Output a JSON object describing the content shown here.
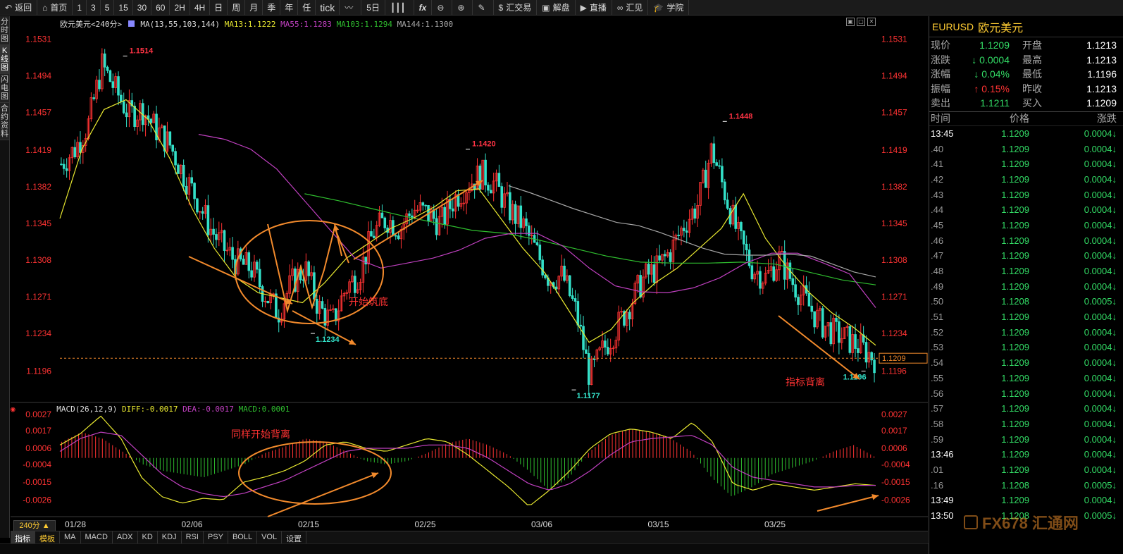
{
  "toolbar": {
    "back": "返回",
    "home": "首页",
    "periods": [
      "1",
      "3",
      "5",
      "15",
      "30",
      "60",
      "2H",
      "4H",
      "日",
      "周",
      "月",
      "季",
      "年",
      "任",
      "tick"
    ],
    "five_day": "5日",
    "fx": "fx",
    "fx_trade": "汇交易",
    "jiepan": "解盘",
    "live": "直播",
    "huijian": "汇见",
    "academy": "学院"
  },
  "left_tabs": [
    "分时图",
    "K线图",
    "闪电图",
    "合约资料"
  ],
  "chart": {
    "title": "欧元美元<240分>",
    "ma_legend": {
      "label": "MA(13,55,103,144)",
      "ma13": "MA13:1.1222",
      "ma55": "MA55:1.1283",
      "ma103": "MA103:1.1294",
      "ma144": "MA144:1.1300"
    },
    "macd_legend": {
      "label": "MACD(26,12,9)",
      "diff": "DIFF:-0.0017",
      "dea": "DEA:-0.0017",
      "macd": "MACD:0.0001"
    },
    "period_button": "240分 ▲",
    "current_price_tag": "1.1209",
    "colors": {
      "up": "#ff3333",
      "down": "#33e0c8",
      "ma13": "#e8e830",
      "ma55": "#2fbf2f",
      "ma103": "#c040c0",
      "ma144": "#a8a8a8",
      "annotation": "#f28a2c"
    },
    "annotations": {
      "start_bottom": "开始筑底",
      "same_divergence": "同样开始背离",
      "indicator_divergence": "指标背离"
    }
  },
  "chart_data": [
    {
      "type": "candlestick",
      "title": "欧元美元<240分>",
      "y_ticks": [
        "1.1531",
        "1.1494",
        "1.1457",
        "1.1419",
        "1.1382",
        "1.1345",
        "1.1308",
        "1.1271",
        "1.1234",
        "1.1196"
      ],
      "x_ticks": [
        "01/28",
        "02/06",
        "02/15",
        "02/25",
        "03/06",
        "03/15",
        "03/25"
      ],
      "ylim": [
        1.117,
        1.154
      ],
      "price_labels": [
        {
          "text": "1.1514",
          "value": 1.1514,
          "x_date": "01/31"
        },
        {
          "text": "1.1420",
          "value": 1.142,
          "x_date": "02/22"
        },
        {
          "text": "1.1448",
          "value": 1.1448,
          "x_date": "03/18"
        },
        {
          "text": "1.1234",
          "value": 1.1234,
          "x_date": "02/15"
        },
        {
          "text": "1.1177",
          "value": 1.1177,
          "x_date": "03/07"
        },
        {
          "text": "1.1196",
          "value": 1.1196,
          "x_date": "03/30"
        }
      ],
      "current_price": 1.1209,
      "close_path": [
        1.1405,
        1.142,
        1.1445,
        1.1505,
        1.148,
        1.1455,
        1.146,
        1.144,
        1.1425,
        1.1395,
        1.137,
        1.134,
        1.132,
        1.1305,
        1.13,
        1.1275,
        1.1255,
        1.1285,
        1.13,
        1.126,
        1.1245,
        1.128,
        1.1295,
        1.1335,
        1.135,
        1.134,
        1.136,
        1.1355,
        1.1345,
        1.137,
        1.1385,
        1.1395,
        1.1385,
        1.136,
        1.1345,
        1.1318,
        1.129,
        1.1292,
        1.1255,
        1.119,
        1.1218,
        1.124,
        1.1265,
        1.129,
        1.13,
        1.1318,
        1.1345,
        1.1365,
        1.142,
        1.1375,
        1.133,
        1.13,
        1.129,
        1.131,
        1.1285,
        1.1265,
        1.1245,
        1.1235,
        1.1228,
        1.122,
        1.1209
      ],
      "ma13": [
        1.135,
        1.142,
        1.146,
        1.147,
        1.145,
        1.141,
        1.136,
        1.132,
        1.129,
        1.1275,
        1.127,
        1.1265,
        1.1285,
        1.131,
        1.1325,
        1.134,
        1.135,
        1.1362,
        1.1378,
        1.138,
        1.135,
        1.132,
        1.1295,
        1.126,
        1.1225,
        1.1238,
        1.1265,
        1.1285,
        1.13,
        1.132,
        1.134,
        1.1375,
        1.133,
        1.13,
        1.1275,
        1.1255,
        1.124,
        1.1222
      ],
      "ma55": [
        1.1375,
        1.1368,
        1.136,
        1.1352,
        1.1345,
        1.1338,
        1.1335,
        1.1328,
        1.132,
        1.1312,
        1.1306,
        1.1305,
        1.1305,
        1.1306,
        1.1304,
        1.1296,
        1.1288,
        1.1283
      ],
      "ma103": [
        1.1435,
        1.143,
        1.142,
        1.14,
        1.137,
        1.134,
        1.131,
        1.13,
        1.1305,
        1.131,
        1.1318,
        1.133,
        1.1335,
        1.1335,
        1.1322,
        1.13,
        1.1282,
        1.1276,
        1.1275,
        1.128,
        1.129,
        1.1305,
        1.1315,
        1.1315,
        1.1305,
        1.1294,
        1.126
      ]
    },
    {
      "type": "bar+line",
      "title": "MACD(26,12,9)",
      "y_ticks": [
        "0.0027",
        "0.0017",
        "0.0006",
        "-0.0004",
        "-0.0015",
        "-0.0026"
      ],
      "ylim": [
        -0.0032,
        0.003
      ],
      "macd_hist": [
        0.001,
        0.0016,
        0.0012,
        0.0004,
        -0.0004,
        -0.0008,
        -0.001,
        -0.0012,
        -0.0008,
        -0.0004,
        0.0003,
        0.0007,
        0.0012,
        0.001,
        0.0004,
        -0.0002,
        -0.0004,
        -0.0002,
        0.0003,
        0.0009,
        0.0012,
        0.0008,
        0.0002,
        -0.0008,
        -0.002,
        -0.0012,
        0.0004,
        0.0014,
        0.0018,
        0.0016,
        0.0012,
        0.0004,
        -0.0012,
        -0.0024,
        -0.0018,
        -0.001,
        -0.0006,
        -0.0002,
        0.0004,
        0.0008,
        0.0001
      ],
      "diff": [
        0.0008,
        0.0015,
        0.0026,
        0.0012,
        -0.0012,
        -0.0024,
        -0.0028,
        -0.0025,
        -0.0026,
        -0.0015,
        -0.0012,
        -0.0008,
        -0.0002,
        0.0008,
        0.001,
        0.0006,
        0.0004,
        0.0008,
        0.0012,
        0.001,
        0.0002,
        -0.0008,
        -0.0018,
        -0.003,
        -0.002,
        -0.0008,
        0.0006,
        0.0015,
        0.0018,
        0.0016,
        0.0012,
        0.0022,
        0.001,
        -0.0016,
        -0.002,
        -0.0016,
        -0.0018,
        -0.002,
        -0.0018,
        -0.0016,
        -0.0017
      ],
      "dea": [
        0.0004,
        0.0012,
        0.0016,
        0.0014,
        0.0002,
        -0.001,
        -0.0018,
        -0.0022,
        -0.0024,
        -0.0022,
        -0.0018,
        -0.0014,
        -0.0008,
        -0.0002,
        0.0004,
        0.0006,
        0.0006,
        0.0006,
        0.0008,
        0.0008,
        0.0006,
        0.0,
        -0.0008,
        -0.0016,
        -0.002,
        -0.0016,
        -0.0008,
        0.0002,
        0.001,
        0.0012,
        0.0013,
        0.0014,
        0.0008,
        -0.0006,
        -0.0012,
        -0.0014,
        -0.0016,
        -0.0018,
        -0.0018,
        -0.0017,
        -0.0017
      ]
    }
  ],
  "right_panel": {
    "code": "EURUSD",
    "name": "欧元美元",
    "quotes": [
      {
        "label": "现价",
        "value": "1.1209",
        "color": "#33dd66",
        "arrow": "",
        "label2": "开盘",
        "value2": "1.1213"
      },
      {
        "label": "涨跌",
        "value": "0.0004",
        "color": "#33dd66",
        "arrow": "↓",
        "label2": "最高",
        "value2": "1.1213"
      },
      {
        "label": "涨幅",
        "value": "0.04%",
        "color": "#33dd66",
        "arrow": "↓",
        "label2": "最低",
        "value2": "1.1196"
      },
      {
        "label": "振幅",
        "value": "0.15%",
        "color": "#ff3333",
        "arrow": "↑",
        "label2": "昨收",
        "value2": "1.1213"
      },
      {
        "label": "卖出",
        "value": "1.1211",
        "color": "#33dd66",
        "arrow": "",
        "label2": "买入",
        "value2": "1.1209"
      }
    ],
    "trade_header": {
      "time": "时间",
      "price": "价格",
      "change": "涨跌"
    },
    "trades": [
      {
        "time": "13:45",
        "price": "1.1209",
        "change": "0.0004↓"
      },
      {
        "time": ".40",
        "price": "1.1209",
        "change": "0.0004↓"
      },
      {
        "time": ".41",
        "price": "1.1209",
        "change": "0.0004↓"
      },
      {
        "time": ".42",
        "price": "1.1209",
        "change": "0.0004↓"
      },
      {
        "time": ".43",
        "price": "1.1209",
        "change": "0.0004↓"
      },
      {
        "time": ".44",
        "price": "1.1209",
        "change": "0.0004↓"
      },
      {
        "time": ".45",
        "price": "1.1209",
        "change": "0.0004↓"
      },
      {
        "time": ".46",
        "price": "1.1209",
        "change": "0.0004↓"
      },
      {
        "time": ".47",
        "price": "1.1209",
        "change": "0.0004↓"
      },
      {
        "time": ".48",
        "price": "1.1209",
        "change": "0.0004↓"
      },
      {
        "time": ".49",
        "price": "1.1209",
        "change": "0.0004↓"
      },
      {
        "time": ".50",
        "price": "1.1208",
        "change": "0.0005↓"
      },
      {
        "time": ".51",
        "price": "1.1209",
        "change": "0.0004↓"
      },
      {
        "time": ".52",
        "price": "1.1209",
        "change": "0.0004↓"
      },
      {
        "time": ".53",
        "price": "1.1209",
        "change": "0.0004↓"
      },
      {
        "time": ".54",
        "price": "1.1209",
        "change": "0.0004↓"
      },
      {
        "time": ".55",
        "price": "1.1209",
        "change": "0.0004↓"
      },
      {
        "time": ".56",
        "price": "1.1209",
        "change": "0.0004↓"
      },
      {
        "time": ".57",
        "price": "1.1209",
        "change": "0.0004↓"
      },
      {
        "time": ".58",
        "price": "1.1209",
        "change": "0.0004↓"
      },
      {
        "time": ".59",
        "price": "1.1209",
        "change": "0.0004↓"
      },
      {
        "time": "13:46",
        "price": "1.1209",
        "change": "0.0004↓"
      },
      {
        "time": ".01",
        "price": "1.1209",
        "change": "0.0004↓"
      },
      {
        "time": ".16",
        "price": "1.1208",
        "change": "0.0005↓"
      },
      {
        "time": "13:49",
        "price": "1.1209",
        "change": "0.0004↓"
      },
      {
        "time": "13:50",
        "price": "1.1208",
        "change": "0.0005↓"
      }
    ]
  },
  "bottom_tabs": [
    "指标",
    "模板",
    "MA",
    "MACD",
    "ADX",
    "KD",
    "KDJ",
    "RSI",
    "PSY",
    "BOLL",
    "VOL",
    "设置"
  ],
  "watermark": "FX678 汇通网"
}
